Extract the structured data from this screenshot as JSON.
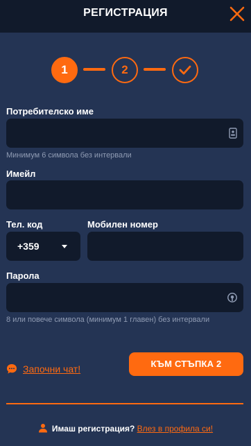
{
  "header": {
    "title": "РЕГИСТРАЦИЯ"
  },
  "steps": [
    {
      "label": "1",
      "state": "active"
    },
    {
      "label": "2",
      "state": "inactive"
    },
    {
      "label": "",
      "icon": "check-icon",
      "state": "inactive"
    }
  ],
  "form": {
    "username": {
      "label": "Потребителско име",
      "value": "",
      "hint": "Минимум 6 символа без интервали"
    },
    "email": {
      "label": "Имейл",
      "value": ""
    },
    "phone_code": {
      "label": "Тел. код",
      "value": "+359"
    },
    "mobile": {
      "label": "Мобилен номер",
      "value": ""
    },
    "password": {
      "label": "Парола",
      "value": "",
      "hint": "8 или повече символа (минимум 1 главен) без интервали"
    }
  },
  "actions": {
    "chat_label": "Започни чат!",
    "next_label": "КЪМ СТЪПКА 2"
  },
  "footer": {
    "question": "Имаш регистрация?",
    "login_link": "Влез в профила си!"
  },
  "colors": {
    "accent": "#ff6a10",
    "background": "#243454",
    "field": "#111a2b",
    "hint": "#8f9bb3"
  }
}
